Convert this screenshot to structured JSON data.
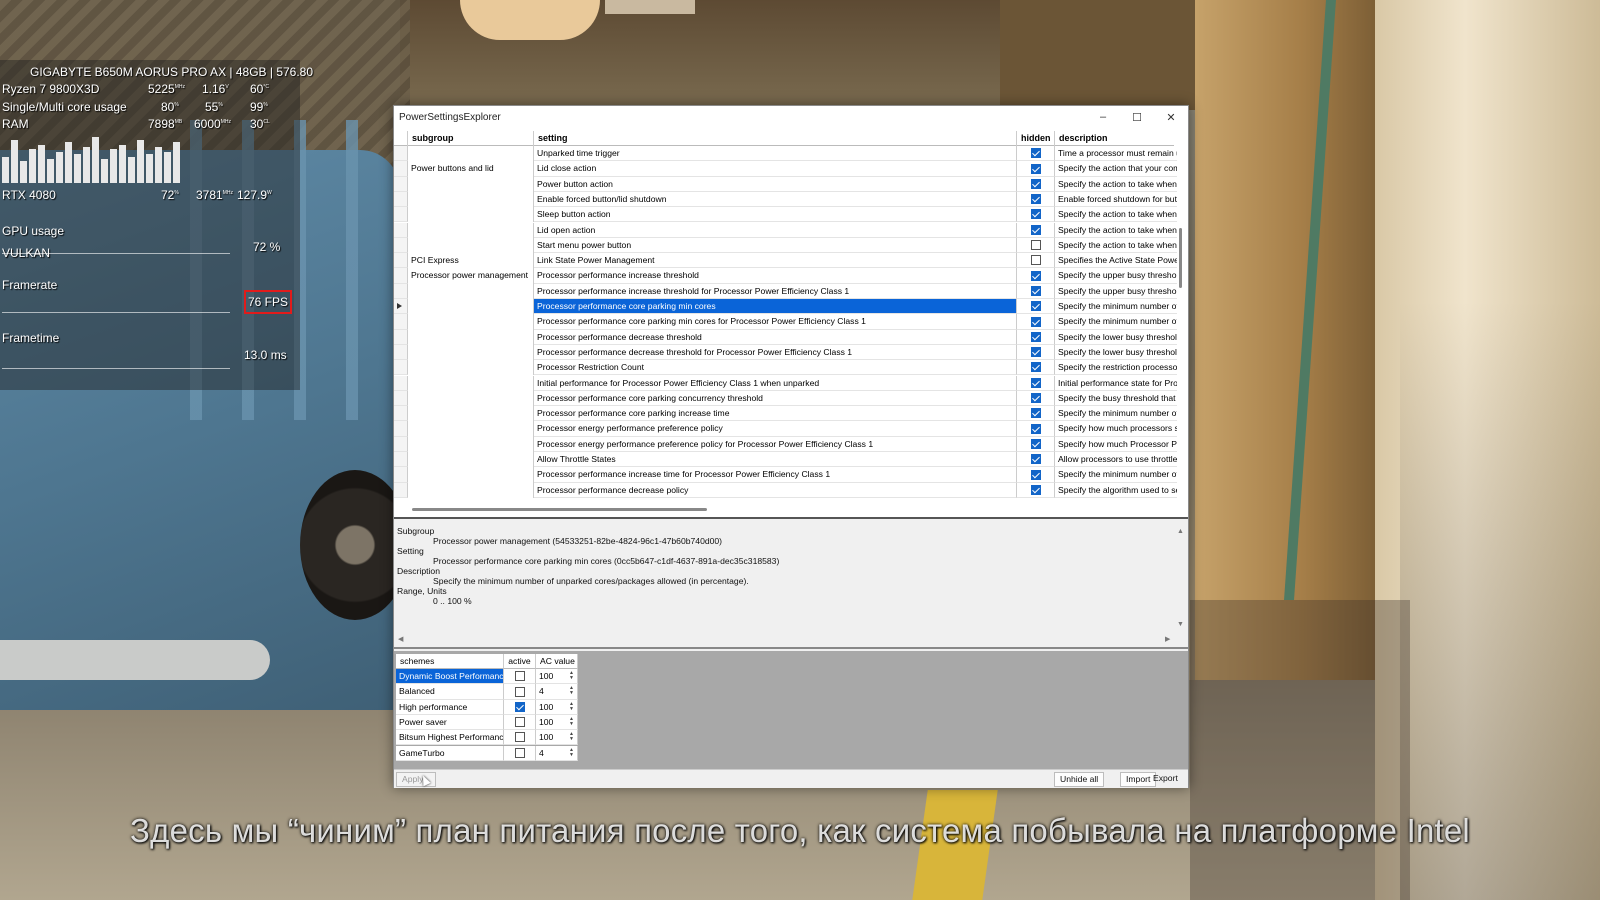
{
  "osd": {
    "board": "GIGABYTE B650M AORUS PRO AX | 48GB | 576.80",
    "cpu_label": "Ryzen 7 9800X3D",
    "cpu_clock": "5225",
    "cpu_clock_unit": "MHz",
    "cpu_volt": "1.16",
    "cpu_volt_unit": "V",
    "cpu_temp": "60",
    "cpu_temp_unit": "°C",
    "core_label": "Single/Multi core usage",
    "core_single": "80",
    "core_multi": "55",
    "core_max": "99",
    "pct_unit": "%",
    "ram_label": "RAM",
    "ram_used": "7898",
    "ram_used_unit": "MB",
    "ram_speed": "6000",
    "ram_speed_unit": "MHz",
    "ram_cl": "30",
    "ram_cl_unit": "CL",
    "gpu_label": "RTX 4080",
    "gpu_load": "72",
    "gpu_clock": "3781",
    "gpu_clock_unit": "MHz",
    "gpu_power": "127.9",
    "gpu_power_unit": "W",
    "gpu_usage_label": "GPU usage",
    "api_label": "VULKAN",
    "gpu_usage_value": "72 %",
    "framerate_label": "Framerate",
    "fps_value": "76 FPS",
    "frametime_label": "Frametime",
    "frametime_value": "13.0 ms",
    "core_bars": [
      0.55,
      0.9,
      0.45,
      0.7,
      0.8,
      0.5,
      0.65,
      0.85,
      0.6,
      0.75,
      0.95,
      0.5,
      0.7,
      0.8,
      0.55,
      0.9,
      0.6,
      0.75,
      0.65,
      0.85
    ]
  },
  "window": {
    "title": "PowerSettingsExplorer",
    "minimize": "–",
    "maximize": "☐",
    "close": "✕",
    "columns": {
      "subgroup": "subgroup",
      "setting": "setting",
      "hidden": "hidden",
      "description": "description"
    },
    "rows": [
      {
        "subgroup": "",
        "setting": "Unparked time trigger",
        "hidden": true,
        "description": "Time a processor must remain ur"
      },
      {
        "subgroup": "Power buttons and lid",
        "setting": "Lid close action",
        "hidden": true,
        "description": "Specify the action that your com"
      },
      {
        "subgroup": "",
        "setting": "Power button action",
        "hidden": true,
        "description": "Specify the action to take when"
      },
      {
        "subgroup": "",
        "setting": "Enable forced button/lid shutdown",
        "hidden": true,
        "description": "Enable forced shutdown for butt"
      },
      {
        "subgroup": "",
        "setting": "Sleep button action",
        "hidden": true,
        "description": "Specify the action to take when"
      },
      {
        "subgroup": "",
        "setting": "Lid open action",
        "hidden": true,
        "description": "Specify the action to take when"
      },
      {
        "subgroup": "",
        "setting": "Start menu power button",
        "hidden": false,
        "description": "Specify the action to take when"
      },
      {
        "subgroup": "PCI Express",
        "setting": "Link State Power Management",
        "hidden": false,
        "description": "Specifies the Active State Powe"
      },
      {
        "subgroup": "Processor power management",
        "setting": "Processor performance increase threshold",
        "hidden": true,
        "description": "Specify the upper busy thresholc"
      },
      {
        "subgroup": "",
        "setting": "Processor performance increase threshold for Processor Power Efficiency Class 1",
        "hidden": true,
        "description": "Specify the upper busy thresholc"
      },
      {
        "subgroup": "",
        "setting": "Processor performance core parking min cores",
        "hidden": true,
        "description": "Specify the minimum number of u",
        "selected": true
      },
      {
        "subgroup": "",
        "setting": "Processor performance core parking min cores for Processor Power Efficiency Class 1",
        "hidden": true,
        "description": "Specify the minimum number of u"
      },
      {
        "subgroup": "",
        "setting": "Processor performance decrease threshold",
        "hidden": true,
        "description": "Specify the lower busy threshold"
      },
      {
        "subgroup": "",
        "setting": "Processor performance decrease threshold for Processor Power Efficiency Class 1",
        "hidden": true,
        "description": "Specify the lower busy threshold"
      },
      {
        "subgroup": "",
        "setting": "Processor Restriction Count",
        "hidden": true,
        "description": "Specify the restriction processor"
      },
      {
        "subgroup": "",
        "setting": "Initial performance for Processor Power Efficiency Class 1 when unparked",
        "hidden": true,
        "description": "Initial performance state for Proc"
      },
      {
        "subgroup": "",
        "setting": "Processor performance core parking concurrency threshold",
        "hidden": true,
        "description": "Specify the busy threshold that n"
      },
      {
        "subgroup": "",
        "setting": "Processor performance core parking increase time",
        "hidden": true,
        "description": "Specify the minimum number of p"
      },
      {
        "subgroup": "",
        "setting": "Processor energy performance preference policy",
        "hidden": true,
        "description": "Specify how much processors sh"
      },
      {
        "subgroup": "",
        "setting": "Processor energy performance preference policy for Processor Power Efficiency Class 1",
        "hidden": true,
        "description": "Specify how much Processor Po"
      },
      {
        "subgroup": "",
        "setting": "Allow Throttle States",
        "hidden": true,
        "description": "Allow processors to use throttle s"
      },
      {
        "subgroup": "",
        "setting": "Processor performance increase time for Processor Power Efficiency Class 1",
        "hidden": true,
        "description": "Specify the minimum number of p"
      },
      {
        "subgroup": "",
        "setting": "Processor performance decrease policy",
        "hidden": true,
        "description": "Specify the algorithm used to sel"
      }
    ],
    "info": {
      "subgroup_label": "Subgroup",
      "subgroup_value": "Processor power management (54533251-82be-4824-96c1-47b60b740d00)",
      "setting_label": "Setting",
      "setting_value": "Processor performance core parking min cores (0cc5b647-c1df-4637-891a-dec35c318583)",
      "description_label": "Description",
      "description_value": "Specify the minimum number of unparked cores/packages allowed (in percentage).",
      "range_label": "Range, Units",
      "range_value": "0 .. 100 %"
    },
    "schemes": {
      "col_name": "schemes",
      "col_active": "active",
      "col_ac": "AC value",
      "rows": [
        {
          "name": "Dynamic Boost Performance",
          "active": false,
          "ac": "100",
          "selected": true
        },
        {
          "name": "Balanced",
          "active": false,
          "ac": "4"
        },
        {
          "name": "High performance",
          "active": true,
          "ac": "100"
        },
        {
          "name": "Power saver",
          "active": false,
          "ac": "100"
        },
        {
          "name": "Bitsum Highest Performance",
          "active": false,
          "ac": "100"
        },
        {
          "name": "GameTurbo",
          "active": false,
          "ac": "4"
        }
      ]
    },
    "buttons": {
      "apply": "Apply",
      "unhide_all": "Unhide all",
      "import": "Import",
      "export": "Export"
    }
  },
  "subtitle": "Здесь мы “чиним” план питания после того, как система побывала на платформе Intel"
}
